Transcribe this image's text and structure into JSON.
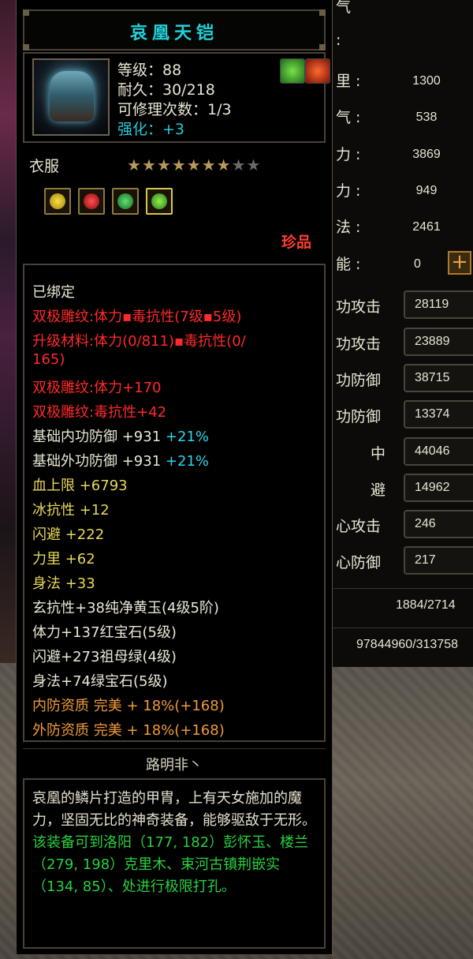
{
  "tooltip": {
    "title": "哀凰天铠",
    "level_line": "等级：88",
    "durability_line": "耐久：30/218",
    "repair_line": "可修理次数：1/3",
    "enhance_line": "强化：+3",
    "type": "衣服",
    "stars_total": 9,
    "stars_filled": 7,
    "rarity": "珍品",
    "attributes": [
      {
        "text": "已绑定",
        "color": "white"
      },
      {
        "text": "双极雕纹:体力▪毒抗性(7级▪5级)",
        "color": "red"
      },
      {
        "text": "升级材料:体力(0/811)▪毒抗性(0/",
        "color": "red"
      },
      {
        "text": "165)",
        "color": "red"
      },
      {
        "text": "双极雕纹:体力+170",
        "color": "red"
      },
      {
        "text": "双极雕纹:毒抗性+42",
        "color": "red"
      },
      {
        "text": "基础内功防御 +931",
        "color": "white",
        "extra": "+21%"
      },
      {
        "text": "基础外功防御 +931",
        "color": "white",
        "extra": "+21%"
      },
      {
        "text": "血上限 +6793",
        "color": "yellow"
      },
      {
        "text": "冰抗性 +12",
        "color": "yellow"
      },
      {
        "text": "闪避 +222",
        "color": "yellow"
      },
      {
        "text": "力里 +62",
        "color": "yellow"
      },
      {
        "text": "身法 +33",
        "color": "yellow"
      },
      {
        "text": "玄抗性+38纯净黄玉(4级5阶)",
        "color": "white"
      },
      {
        "text": "体力+137红宝石(5级)",
        "color": "white"
      },
      {
        "text": "闪避+273祖母绿(4级)",
        "color": "white"
      },
      {
        "text": "身法+74绿宝石(5级)",
        "color": "white"
      },
      {
        "text": "内防资质 完美 + 18%(+168)",
        "color": "orange"
      },
      {
        "text": "外防资质 完美 + 18%(+168)",
        "color": "orange"
      }
    ],
    "owner": "路明非丶",
    "description": "哀凰的鳞片打造的甲胄，上有天女施加的魔力，坚固无比的神奇装备，能够驱敌于无形。",
    "location_text": "该装备可到洛阳（177, 182）彭怀玉、楼兰（279, 198）克里木、束河古镇荆嵌实（134, 85）、处进行极限打孔。"
  },
  "stats_panel": {
    "top_label": "气",
    "top2_label": ":",
    "rows": [
      {
        "label": "里 :",
        "value": "1300"
      },
      {
        "label": "气 :",
        "value": "538"
      },
      {
        "label": "力 :",
        "value": "3869"
      },
      {
        "label": "力 :",
        "value": "949"
      },
      {
        "label": "法 :",
        "value": "2461"
      },
      {
        "label": "能 :",
        "value": "0"
      }
    ],
    "box_rows": [
      {
        "label": "功攻击",
        "value": "28119"
      },
      {
        "label": "功攻击",
        "value": "23889"
      },
      {
        "label": "功防御",
        "value": "38715"
      },
      {
        "label": "功防御",
        "value": "13374"
      },
      {
        "label": "中",
        "value": "44046"
      },
      {
        "label": "避",
        "value": "14962"
      },
      {
        "label": "心攻击",
        "value": "246"
      },
      {
        "label": "心防御",
        "value": "217"
      }
    ],
    "hp": "1884/2714",
    "exp": "97844960/313758"
  },
  "colors": {
    "title": "#21d0d8",
    "red": "#ff2a2a",
    "yellow": "#e8d85a",
    "orange": "#f09a3a",
    "cyan": "#29d7ea",
    "green": "#2ad040"
  }
}
